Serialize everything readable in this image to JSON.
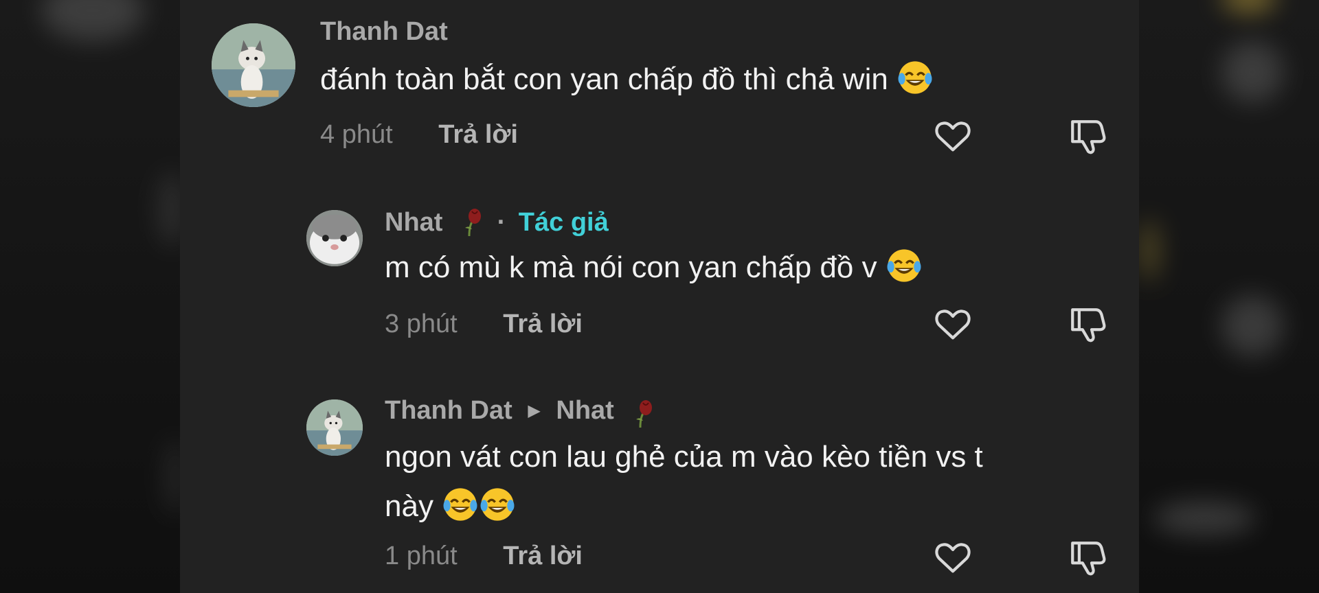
{
  "comments": [
    {
      "user": "Thanh Dat",
      "text": "đánh toàn bắt con yan chấp đồ thì chả win",
      "emoji": [
        "face-with-tears-of-joy"
      ],
      "time": "4 phút",
      "reply_label": "Trả lời"
    },
    {
      "user": "Nhat",
      "user_emoji": "wilted-rose",
      "separator": "·",
      "author_tag": "Tác giả",
      "text": "m có mù k mà nói con yan chấp đồ v",
      "emoji": [
        "face-with-tears-of-joy"
      ],
      "time": "3 phút",
      "reply_label": "Trả lời"
    },
    {
      "user": "Thanh Dat",
      "reply_to": "Nhat",
      "reply_to_emoji": "wilted-rose",
      "text_line1": "ngon vát con lau ghẻ của m vào kèo tiền vs t",
      "text_line2": "này",
      "emoji": [
        "face-with-tears-of-joy",
        "face-with-tears-of-joy"
      ],
      "time": "1 phút",
      "reply_label": "Trả lời"
    }
  ],
  "icons": {
    "like": "heart-outline-icon",
    "dislike": "thumbs-down-outline-icon"
  },
  "colors": {
    "panel_bg": "#222222",
    "author_tag": "#41d0d8",
    "text": "#f2f2f2",
    "muted": "#8a8a8a"
  }
}
